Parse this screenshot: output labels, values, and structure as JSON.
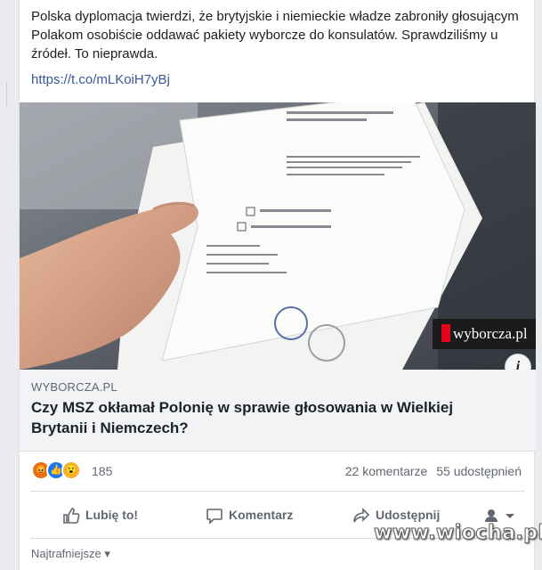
{
  "post": {
    "text": "Polska dyplomacja twierdzi, że brytyjskie i niemieckie władze zabroniły głosującym Polakom osobiście oddawać pakiety wyborcze do konsulatów. Sprawdziliśmy u źródeł. To nieprawda.",
    "link": "https://t.co/mLKoiH7yBj"
  },
  "photo": {
    "source_badge": "wyborcza.pl",
    "info_icon": "i"
  },
  "link_preview": {
    "domain": "WYBORCZA.PL",
    "title": "Czy MSZ okłamał Polonię w sprawie głosowania w Wielkiej Brytanii i Niemczech?"
  },
  "stats": {
    "reactions_count": "185",
    "comments": "22 komentarze",
    "shares": "55 udostępnień",
    "reaction_icons": [
      "angry-icon",
      "like-icon",
      "wow-icon"
    ]
  },
  "actions": {
    "like": "Lubię to!",
    "comment": "Komentarz",
    "share": "Udostępnij"
  },
  "comments": {
    "sort_label": "Najtrafniejsze"
  },
  "watermark": "www.wiocha.pl",
  "colors": {
    "link": "#385898",
    "like_blue": "#1877f2",
    "brand_red": "#e3061b"
  }
}
